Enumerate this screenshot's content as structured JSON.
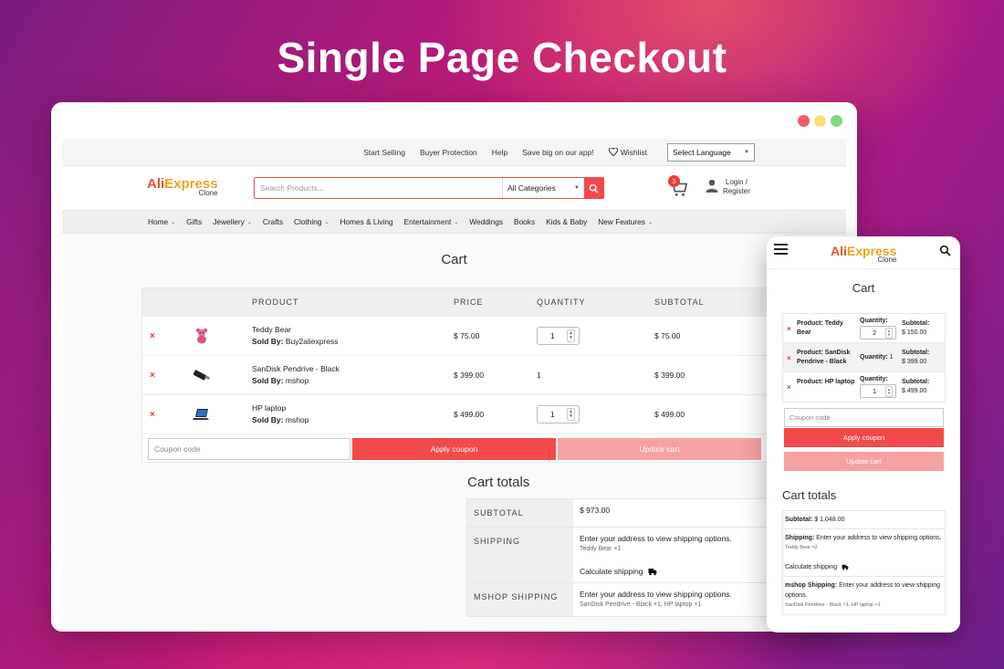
{
  "hero": {
    "title": "Single Page Checkout"
  },
  "colors": {
    "accent": "#f24a4a",
    "accent_light": "#f7a2a2",
    "remove": "#e8332f"
  },
  "topbar": {
    "links": [
      "Start Selling",
      "Buyer Protection",
      "Help",
      "Save big on our app!"
    ],
    "wishlist": "Wishlist",
    "language": "Select Language"
  },
  "header": {
    "logo_main_a": "Ali",
    "logo_main_b": "Express",
    "logo_sub": "Clone",
    "search_placeholder": "Search Products...",
    "category": "All Categories",
    "cart_count": "3",
    "login_line1": "Login /",
    "login_line2": "Register"
  },
  "nav": {
    "items": [
      {
        "label": "Home",
        "dropdown": true
      },
      {
        "label": "Gifts",
        "dropdown": false
      },
      {
        "label": "Jewellery",
        "dropdown": true
      },
      {
        "label": "Crafts",
        "dropdown": false
      },
      {
        "label": "Clothing",
        "dropdown": true
      },
      {
        "label": "Homes & Living",
        "dropdown": false
      },
      {
        "label": "Entertainment",
        "dropdown": true
      },
      {
        "label": "Weddings",
        "dropdown": false
      },
      {
        "label": "Books",
        "dropdown": false
      },
      {
        "label": "Kids & Baby",
        "dropdown": false
      },
      {
        "label": "New Features",
        "dropdown": true
      }
    ]
  },
  "cart": {
    "title": "Cart",
    "headers": {
      "product": "PRODUCT",
      "price": "PRICE",
      "quantity": "QUANTITY",
      "subtotal": "SUBTOTAL"
    },
    "sold_by_label": "Sold By:",
    "items": [
      {
        "name": "Teddy Bear",
        "seller": "Buy2aliexpress",
        "price": "$ 75.00",
        "qty": "1",
        "qty_editable": true,
        "subtotal": "$ 75.00",
        "icon": "teddy-bear-icon"
      },
      {
        "name": "SanDisk Pendrive - Black",
        "seller": "mshop",
        "price": "$ 399.00",
        "qty": "1",
        "qty_editable": false,
        "subtotal": "$ 399.00",
        "icon": "pendrive-icon"
      },
      {
        "name": "HP laptop",
        "seller": "mshop",
        "price": "$ 499.00",
        "qty": "1",
        "qty_editable": true,
        "subtotal": "$ 499.00",
        "icon": "laptop-icon"
      }
    ],
    "coupon_placeholder": "Coupon code",
    "apply_label": "Apply coupon",
    "update_label": "Update cart"
  },
  "totals": {
    "title": "Cart totals",
    "subtotal_label": "SUBTOTAL",
    "subtotal_value": "$ 973.00",
    "shipping_label": "SHIPPING",
    "shipping_text": "Enter your address to view shipping options.",
    "shipping_items": "Teddy Bear ×1",
    "calculate_label": "Calculate shipping",
    "mshop_label": "MSHOP SHIPPING",
    "mshop_text": "Enter your address to view shipping options.",
    "mshop_items": "SanDisk Pendrive - Black ×1, HP laptop ×1"
  },
  "mobile": {
    "cart_title": "Cart",
    "product_prefix": "Product:",
    "quantity_label": "Quantity:",
    "subtotal_label": "Subtotal:",
    "items": [
      {
        "name": "Product: Teddy Bear",
        "qty": "2",
        "qty_editable": true,
        "subtotal": "$ 150.00"
      },
      {
        "name": "Product: SanDisk Pendrive - Black",
        "qty": "1",
        "qty_editable": false,
        "subtotal": "$ 399.00"
      },
      {
        "name": "Product: HP laptop",
        "qty": "1",
        "qty_editable": true,
        "subtotal": "$ 499.00"
      }
    ],
    "coupon_placeholder": "Coupon code",
    "apply_label": "Apply coupon",
    "update_label": "Update cart",
    "totals_title": "Cart totals",
    "subtotal_label_t": "Subtotal:",
    "subtotal_value": "$ 1,048.00",
    "shipping_label": "Shipping:",
    "shipping_text": "Enter your address to view shipping options.",
    "shipping_items": "Teddy Bear ×2",
    "calculate_label": "Calculate shipping",
    "mshop_label": "mshop Shipping:",
    "mshop_text": "Enter your address to view shipping options.",
    "mshop_items": "SanDisk Pendrive - Black ×1, HP laptop ×1"
  }
}
